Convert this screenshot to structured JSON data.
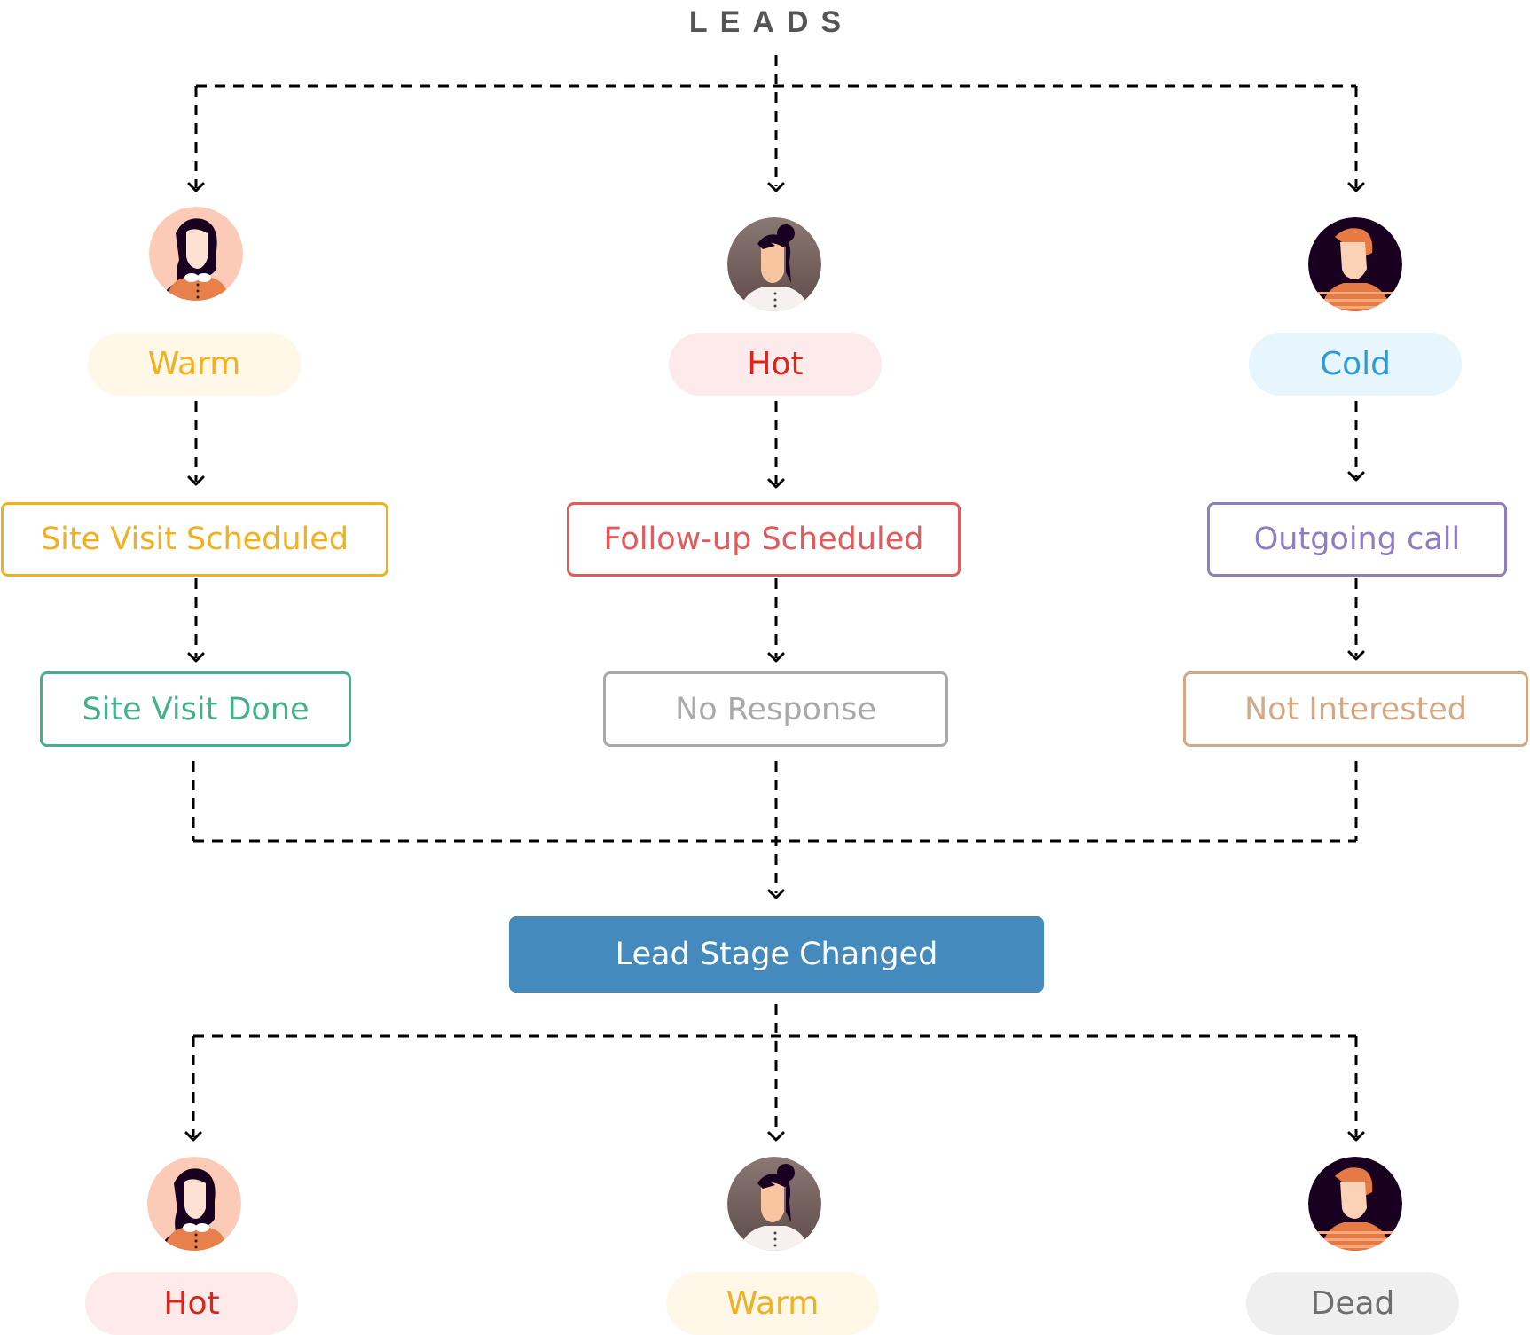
{
  "title": "LEADS",
  "colors": {
    "warm": "#f2b01e",
    "warm_bg": "#fff7e8",
    "hot": "#d9261c",
    "hot_bg": "#fdeaea",
    "cold": "#2e9bd6",
    "cold_bg": "#e7f6fd",
    "dead": "#6e6e6e",
    "dead_bg": "#efefef",
    "stage_bg": "#458abd",
    "connector": "#000000"
  },
  "top_row": [
    {
      "avatar": "woman-long-hair-avatar",
      "status": "Warm",
      "first_step": "Site Visit Scheduled",
      "second_step": "Site Visit Done"
    },
    {
      "avatar": "woman-bun-hair-avatar",
      "status": "Hot",
      "first_step": "Follow-up Scheduled",
      "second_step": "No Response"
    },
    {
      "avatar": "man-striped-shirt-avatar",
      "status": "Cold",
      "first_step": "Outgoing call",
      "second_step": "Not Interested"
    }
  ],
  "merge_node": "Lead Stage Changed",
  "bottom_row": [
    {
      "avatar": "woman-long-hair-avatar",
      "status": "Hot"
    },
    {
      "avatar": "woman-bun-hair-avatar",
      "status": "Warm"
    },
    {
      "avatar": "man-striped-shirt-avatar",
      "status": "Dead"
    }
  ]
}
